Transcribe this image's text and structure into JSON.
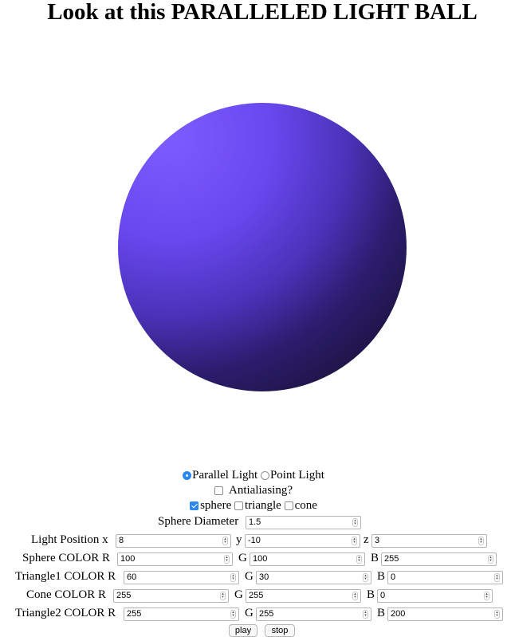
{
  "page": {
    "title": "Look at this PARALLELED LIGHT BALL"
  },
  "ball": {
    "color": "#6a4cf0"
  },
  "light_type": {
    "options": [
      {
        "label": "Parallel Light",
        "selected": true
      },
      {
        "label": "Point Light",
        "selected": false
      }
    ]
  },
  "antialiasing": {
    "label": "Antialiasing?",
    "checked": false
  },
  "shapes": [
    {
      "label": "sphere",
      "checked": true
    },
    {
      "label": "triangle",
      "checked": false
    },
    {
      "label": "cone",
      "checked": false
    }
  ],
  "sphere_diameter": {
    "label": "Sphere Diameter",
    "value": "1.5"
  },
  "light_position": {
    "label": "Light Position x",
    "x": "8",
    "y_label": "y",
    "y": "-10",
    "z_label": "z",
    "z": "3"
  },
  "sphere_color": {
    "label": "Sphere COLOR R",
    "r": "100",
    "g_label": "G",
    "g": "100",
    "b_label": "B",
    "b": "255"
  },
  "triangle1_color": {
    "label": "Triangle1 COLOR R",
    "r": "60",
    "g_label": "G",
    "g": "30",
    "b_label": "B",
    "b": "0"
  },
  "cone_color": {
    "label": "Cone COLOR R",
    "r": "255",
    "g_label": "G",
    "g": "255",
    "b_label": "B",
    "b": "0"
  },
  "triangle2_color": {
    "label": "Triangle2 COLOR R",
    "r": "255",
    "g_label": "G",
    "g": "255",
    "b_label": "B",
    "b": "200"
  },
  "buttons": {
    "play": "play",
    "stop": "stop"
  }
}
